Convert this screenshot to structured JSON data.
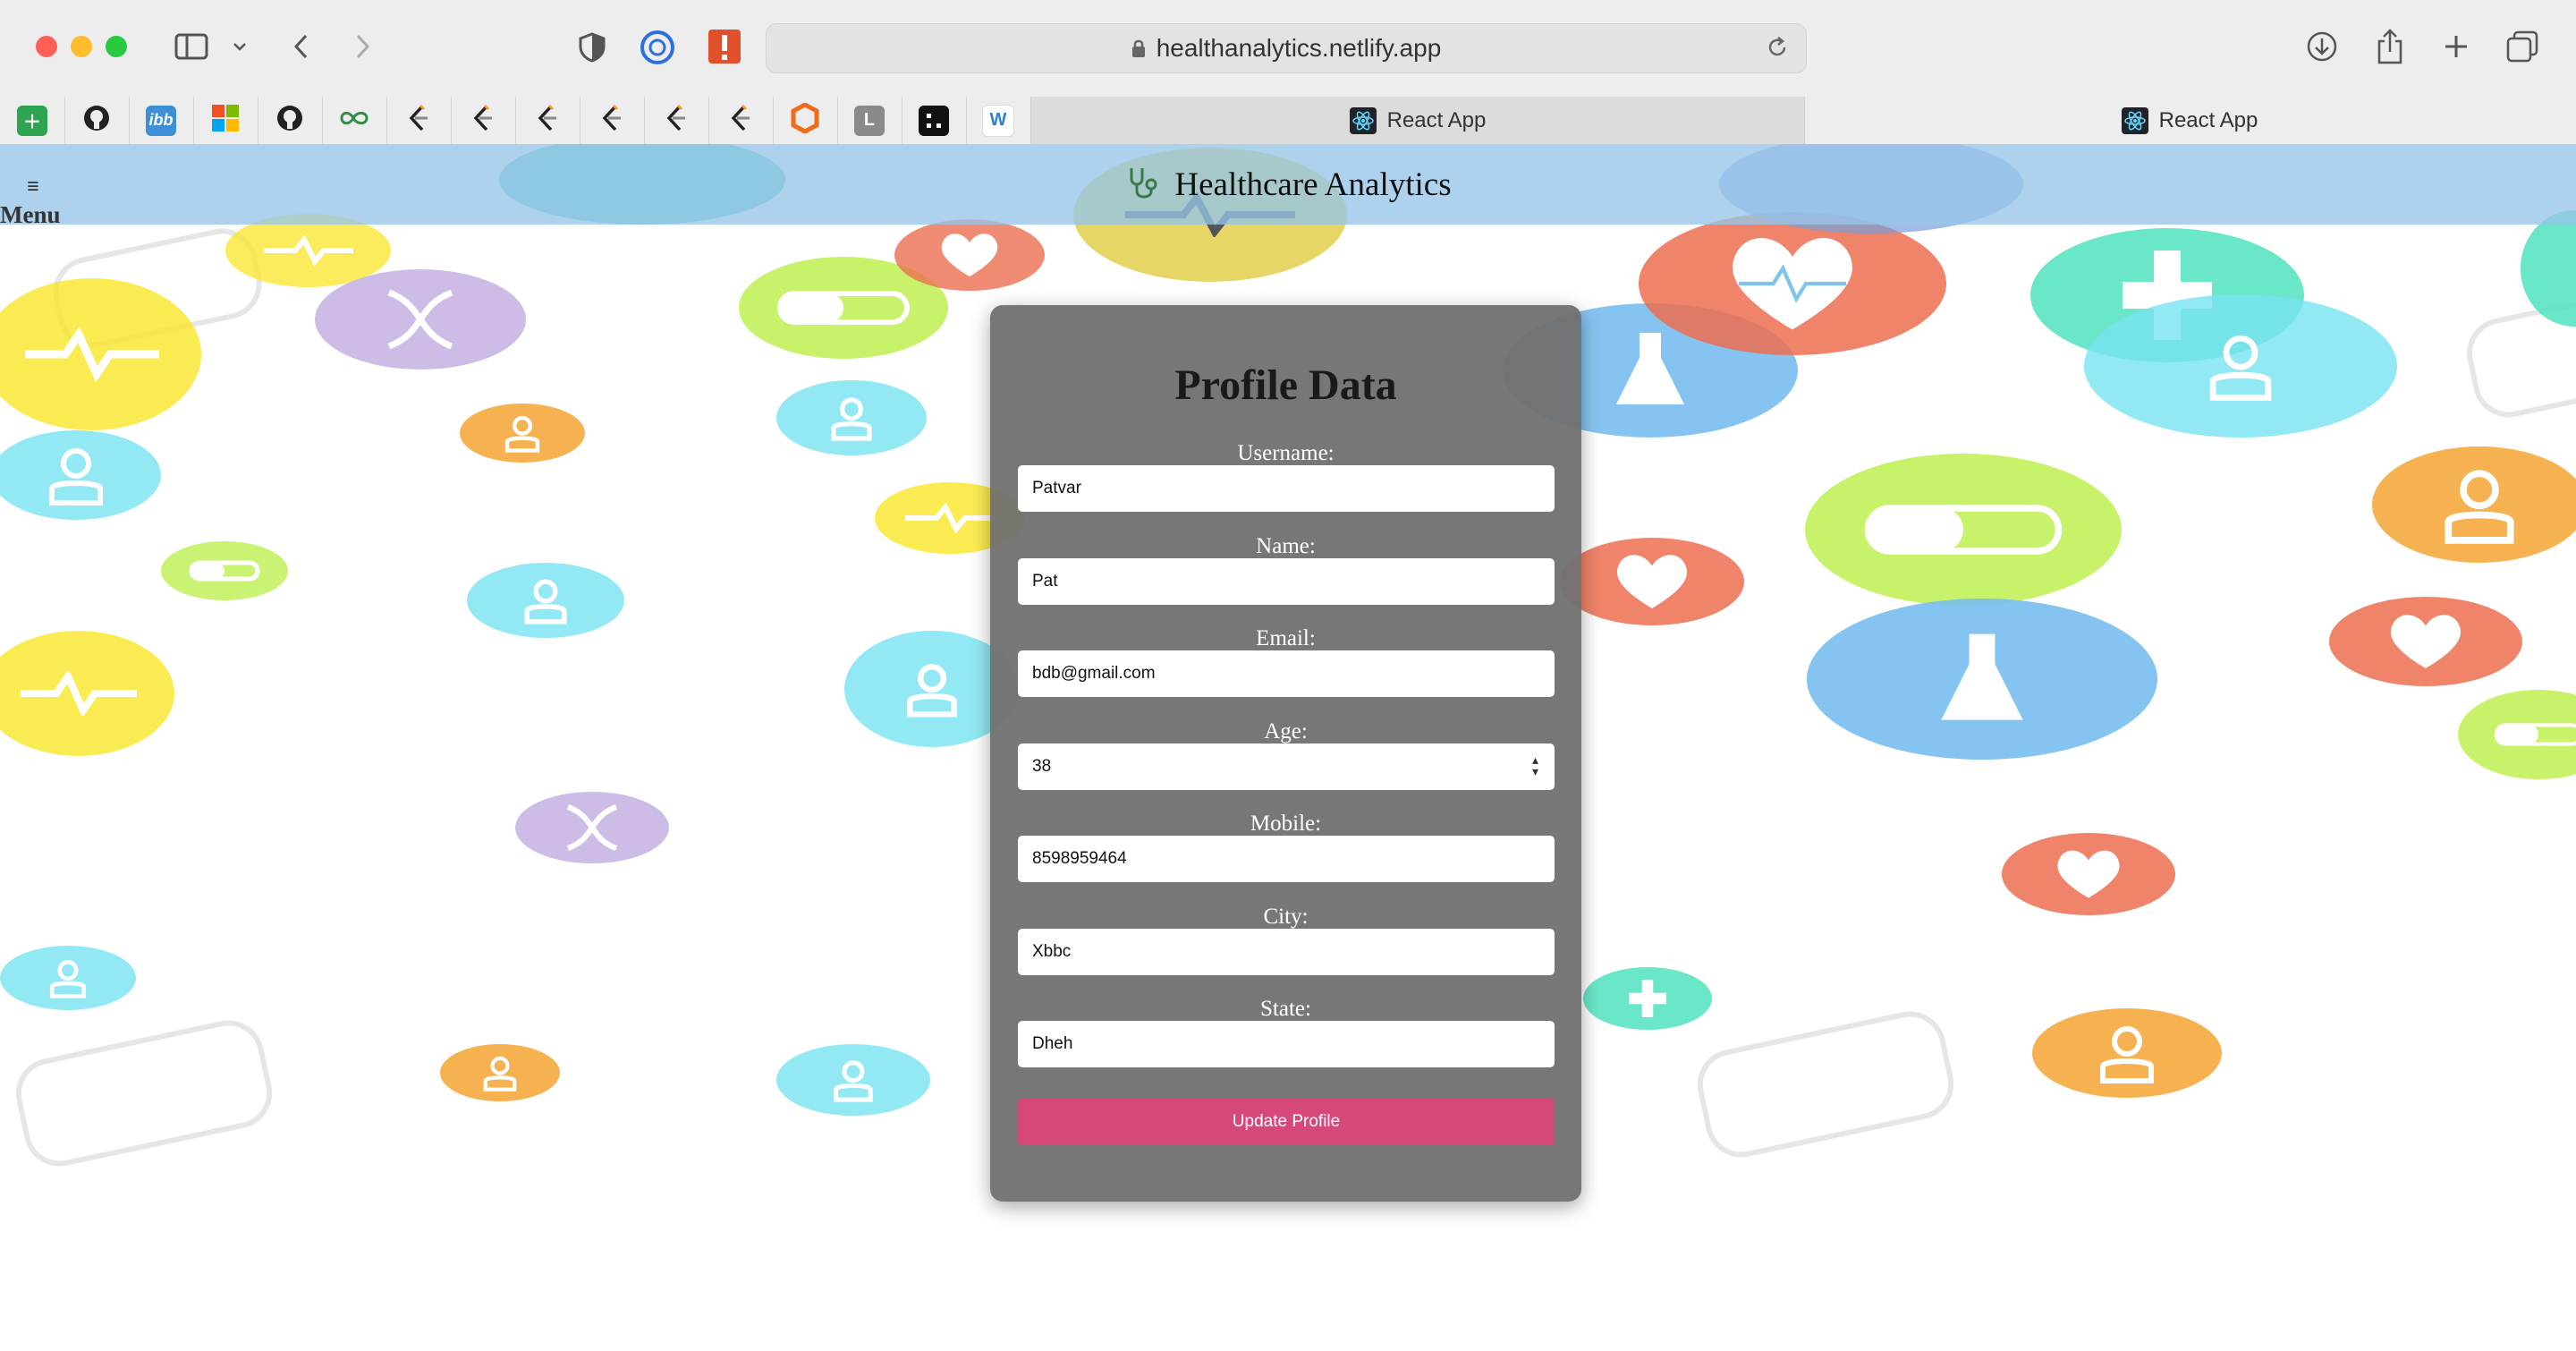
{
  "browser": {
    "url": "healthanalytics.netlify.app",
    "tabs": [
      {
        "title": "React App",
        "active": true
      },
      {
        "title": "React App",
        "active": false
      }
    ],
    "favorites": [
      "plus-icon",
      "github-icon",
      "ibb-icon",
      "microsoft-icon",
      "github-icon",
      "gfg-icon",
      "leetcode-icon",
      "leetcode-icon",
      "leetcode-icon",
      "leetcode-icon",
      "leetcode-icon",
      "leetcode-icon",
      "hexagon-icon",
      "l-icon",
      "graph-icon",
      "w-icon"
    ],
    "favorite_labels": {
      "ibb": "ibb",
      "l": "L",
      "w": "W"
    }
  },
  "app": {
    "brand": "Healthcare Analytics",
    "menu_label": "Menu",
    "menu_glyph": "≡"
  },
  "profile": {
    "title": "Profile Data",
    "fields": {
      "username": {
        "label": "Username:",
        "value": "Patvar"
      },
      "name": {
        "label": "Name:",
        "value": "Pat"
      },
      "email": {
        "label": "Email:",
        "value": "bdb@gmail.com"
      },
      "age": {
        "label": "Age:",
        "value": "38"
      },
      "mobile": {
        "label": "Mobile:",
        "value": "8598959464"
      },
      "city": {
        "label": "City:",
        "value": "Xbbc"
      },
      "state": {
        "label": "State:",
        "value": "Dheh"
      }
    },
    "submit_label": "Update Profile"
  },
  "colors": {
    "header_bg": "#97c5e8",
    "button": "#d6477a",
    "card": "#707070"
  }
}
